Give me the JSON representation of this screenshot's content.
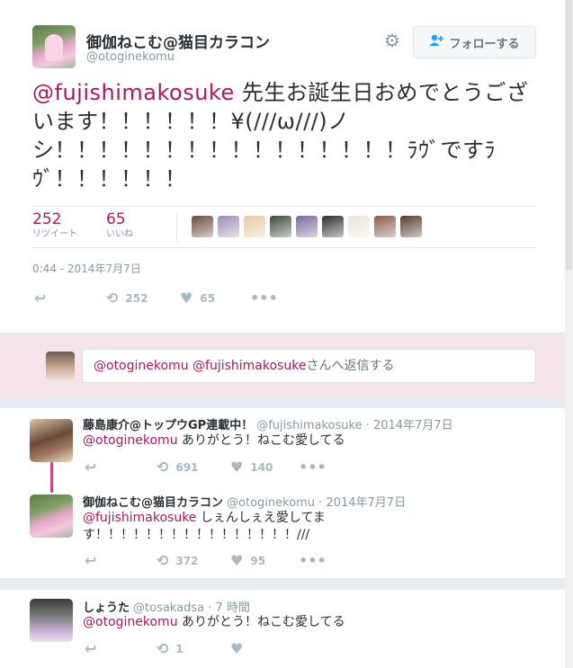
{
  "main_tweet": {
    "author_name": "御伽ねこむ@猫目カラコン",
    "author_handle": "@otoginekomu",
    "follow_label": "フォローする",
    "text_mention": "@fujishimakosuke",
    "text_body": " 先生お誕生日おめでとうございます！！！！！！¥(///ω///)ノシ！！！！！！！！！！！！！！！！ﾗｳﾞですﾗｳﾞ！！！！！！",
    "retweets_count": "252",
    "retweets_label": "リツイート",
    "likes_count": "65",
    "likes_label": "いいね",
    "timestamp": "0:44 - 2014年7月7日",
    "action_retweet_count": "252",
    "action_like_count": "65",
    "likers_colors": [
      "#6b4a3a",
      "#a08db5",
      "#e8c7a4",
      "#3d4a3a",
      "#7a6aa0",
      "#2f2f2f",
      "#e9e6d8",
      "#8a5a48",
      "#5a3a2a"
    ]
  },
  "reply_box": {
    "mention_1": "@otoginekomu",
    "mention_2": "@fujishimakosuke",
    "suffix": "さんへ返信する"
  },
  "replies": [
    {
      "name": "藤島康介@トップウGP連載中！",
      "meta": "@fujishimakosuke · 2014年7月7日",
      "mention": "@otoginekomu",
      "text": " ありがとう！ねこむ愛してる",
      "retweets": "691",
      "likes": "140"
    },
    {
      "name": "御伽ねこむ@猫目カラコン",
      "meta": "@otoginekomu · 2014年7月7日",
      "mention": "@fujishimakosuke",
      "text": " しぇんしぇえ愛してます！！！！！！！！！！！！！！！！///",
      "retweets": "372",
      "likes": "95"
    },
    {
      "name": "しょうた",
      "meta": "@tosakadsa · 7 時間",
      "mention": "@otoginekomu",
      "text": " ありがとう！ねこむ愛してる",
      "retweets": "1",
      "likes": ""
    }
  ]
}
